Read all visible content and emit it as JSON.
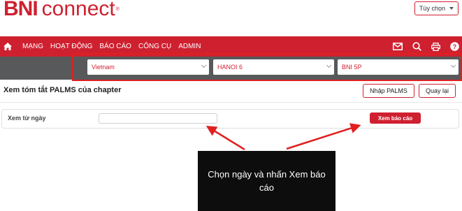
{
  "header": {
    "logo_bni": "BNI",
    "logo_connect": "connect",
    "logo_reg": "®",
    "options_label": "Tùy chọn"
  },
  "nav": {
    "items": [
      "MẠNG",
      "HOẠT ĐỘNG",
      "BÁO CÁO",
      "CÔNG CỤ",
      "ADMIN"
    ],
    "icons": [
      "home-icon",
      "mail-icon",
      "search-icon",
      "print-icon",
      "help-icon"
    ]
  },
  "filters": {
    "country": "Vietnam",
    "region": "HANOI 6",
    "chapter": "BNI 5P"
  },
  "page": {
    "title": "Xem tóm tắt PALMS của chapter",
    "import_label": "Nhập PALMS",
    "back_label": "Quay lại"
  },
  "form": {
    "from_label": "Xem từ ngày",
    "from_value": "",
    "view_report_label": "Xem báo cáo"
  },
  "annotation": {
    "callout_text": "Chọn ngày và nhấn Xem báo cáo"
  },
  "colors": {
    "brand_red": "#cf2030",
    "filter_bar": "#58595b",
    "annotation_red": "#e02020",
    "callout_bg": "#0d0d0d"
  }
}
